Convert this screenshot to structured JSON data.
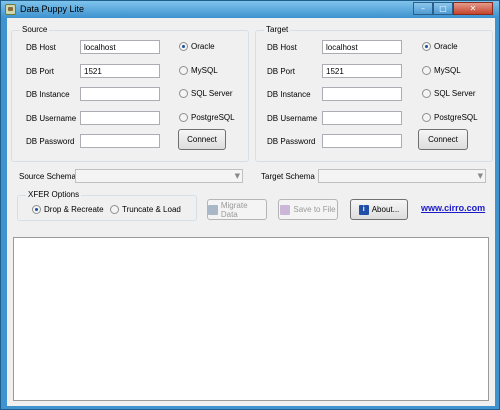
{
  "window": {
    "title": "Data Puppy Lite",
    "controls": [
      "–",
      "□",
      "✕"
    ]
  },
  "source": {
    "group_title": "Source",
    "labels": {
      "host": "DB Host",
      "port": "DB Port",
      "instance": "DB Instance",
      "username": "DB Username",
      "password": "DB Password"
    },
    "values": {
      "host": "localhost",
      "port": "1521",
      "instance": "",
      "username": "",
      "password": ""
    },
    "db_types": [
      "Oracle",
      "MySQL",
      "SQL Server",
      "PostgreSQL"
    ],
    "selected_db": "Oracle",
    "connect_label": "Connect"
  },
  "target": {
    "group_title": "Target",
    "labels": {
      "host": "DB Host",
      "port": "DB Port",
      "instance": "DB Instance",
      "username": "DB Username",
      "password": "DB Password"
    },
    "values": {
      "host": "localhost",
      "port": "1521",
      "instance": "",
      "username": "",
      "password": ""
    },
    "db_types": [
      "Oracle",
      "MySQL",
      "SQL Server",
      "PostgreSQL"
    ],
    "selected_db": "Oracle",
    "connect_label": "Connect"
  },
  "schema": {
    "source_label": "Source Schema",
    "target_label": "Target Schema",
    "source_value": "",
    "target_value": ""
  },
  "xfer": {
    "group_title": "XFER Options",
    "options": [
      "Drop & Recreate",
      "Truncate & Load"
    ],
    "selected": "Drop & Recreate"
  },
  "actions": {
    "migrate_label": "Migrate Data",
    "save_label": "Save to File",
    "about_label": "About...",
    "link_text": "www.cirro.com"
  },
  "icons": {
    "app": "puppy-app-icon",
    "migrate": "database-icon",
    "save": "save-file-icon",
    "about": "info-icon"
  }
}
